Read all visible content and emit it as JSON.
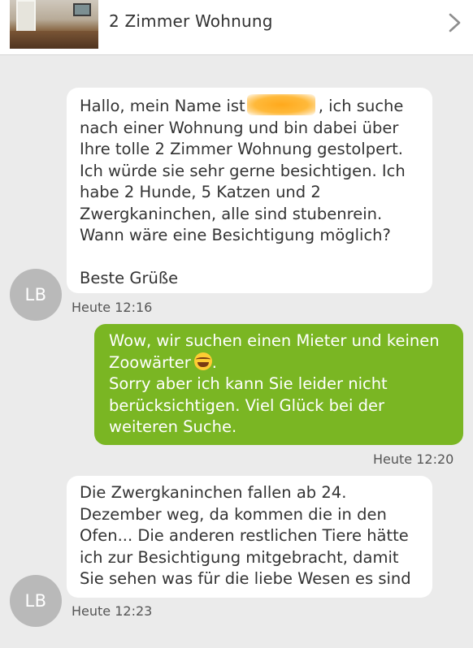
{
  "header": {
    "title": "2 Zimmer Wohnung",
    "thumbnail_icon": "apartment-photo",
    "chevron_icon": "chevron-right-icon"
  },
  "messages": [
    {
      "direction": "incoming",
      "avatar_initials": "LB",
      "lines_before_redaction": "Hallo, mein Name ist",
      "lines_after_redaction": ", ich suche",
      "lines": [
        "nach einer Wohnung und bin dabei über",
        "Ihre tolle 2 Zimmer Wohnung gestolpert.",
        "Ich würde sie sehr gerne besichtigen. Ich",
        "habe 2 Hunde, 5 Katzen und 2",
        "Zwergkaninchen, alle sind stubenrein.",
        "Wann wäre eine Besichtigung möglich?"
      ],
      "closing": "Beste Grüße",
      "time": "Heute 12:16"
    },
    {
      "direction": "outgoing",
      "lines": [
        "Wow, wir suchen einen Mieter und keinen",
        "Zoowärter",
        "Sorry aber ich kann Sie leider nicht",
        "berücksichtigen. Viel Glück bei der",
        "weiteren Suche."
      ],
      "emoji": "laughing-crying-emoji",
      "time": "Heute 12:20"
    },
    {
      "direction": "incoming",
      "avatar_initials": "LB",
      "lines": [
        "Die Zwergkaninchen fallen ab 24.",
        "Dezember weg, da kommen die in den",
        "Ofen... Die anderen restlichen Tiere hätte",
        "ich zur Besichtigung mitgebracht, damit",
        "Sie sehen was für die liebe Wesen es sind"
      ],
      "time": "Heute 12:23"
    }
  ],
  "colors": {
    "background": "#ebebeb",
    "incoming_bubble": "#ffffff",
    "outgoing_bubble": "#7ab623",
    "avatar": "#b9b9b9",
    "redaction": "#ffa91c"
  }
}
